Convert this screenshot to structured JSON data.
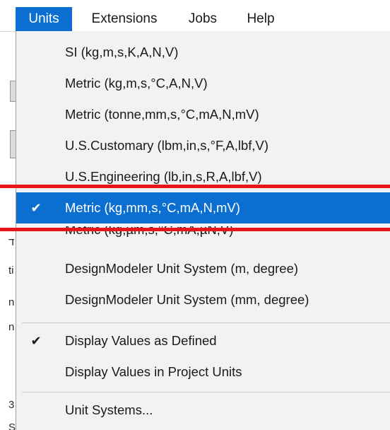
{
  "menubar": {
    "items": [
      {
        "label": "Units",
        "active": true
      },
      {
        "label": "Extensions",
        "active": false
      },
      {
        "label": "Jobs",
        "active": false
      },
      {
        "label": "Help",
        "active": false
      }
    ]
  },
  "units_menu": {
    "unit_systems": [
      {
        "label": "SI (kg,m,s,K,A,N,V)",
        "checked": false
      },
      {
        "label": "Metric (kg,m,s,°C,A,N,V)",
        "checked": false
      },
      {
        "label": "Metric (tonne,mm,s,°C,mA,N,mV)",
        "checked": false
      },
      {
        "label": "U.S.Customary (lbm,in,s,°F,A,lbf,V)",
        "checked": false
      },
      {
        "label": "U.S.Engineering (lb,in,s,R,A,lbf,V)",
        "checked": false
      },
      {
        "label": "Metric (kg,mm,s,°C,mA,N,mV)",
        "checked": true,
        "selected": true
      },
      {
        "label": "Metric (kg,µm,s,°C,mA,µN,V)",
        "checked": false
      },
      {
        "label": "DesignModeler Unit System (m, degree)",
        "checked": false
      },
      {
        "label": "DesignModeler Unit System (mm, degree)",
        "checked": false
      }
    ],
    "display_options": [
      {
        "label": "Display Values as Defined",
        "checked": true
      },
      {
        "label": "Display Values in Project Units",
        "checked": false
      }
    ],
    "manage": {
      "label": "Unit Systems..."
    },
    "check_glyph": "✔"
  },
  "background_fragments": [
    "ד",
    "ti",
    "n",
    "n",
    "r",
    "3",
    "S"
  ],
  "colors": {
    "highlight": "#0a6fd1",
    "menu_bg": "#f2f2f2",
    "annotation_red": "#e8141c"
  }
}
